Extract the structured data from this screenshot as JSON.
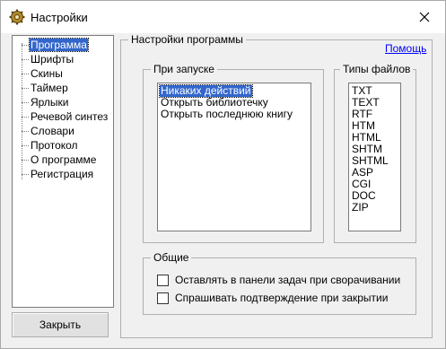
{
  "window": {
    "title": "Настройки"
  },
  "tree": {
    "items": [
      {
        "label": "Программа",
        "selected": true
      },
      {
        "label": "Шрифты"
      },
      {
        "label": "Скины"
      },
      {
        "label": "Таймер"
      },
      {
        "label": "Ярлыки"
      },
      {
        "label": "Речевой синтез"
      },
      {
        "label": "Словари"
      },
      {
        "label": "Протокол"
      },
      {
        "label": "О программе"
      },
      {
        "label": "Регистрация"
      }
    ]
  },
  "buttons": {
    "close_label": "Закрыть"
  },
  "settings_group": {
    "title": "Настройки программы",
    "help_link": "Помощь"
  },
  "startup": {
    "title": "При запуске",
    "options": [
      {
        "label": "Никаких действий",
        "selected": true
      },
      {
        "label": "Открыть библиотечку"
      },
      {
        "label": "Открыть последнюю книгу"
      }
    ]
  },
  "file_types": {
    "title": "Типы файлов",
    "items": [
      "TXT",
      "TEXT",
      "RTF",
      "HTM",
      "HTML",
      "SHTM",
      "SHTML",
      "ASP",
      "CGI",
      "DOC",
      "ZIP"
    ]
  },
  "general": {
    "title": "Общие",
    "checkboxes": [
      {
        "label": "Оставлять в панели задач при сворачивании",
        "checked": false
      },
      {
        "label": "Спрашивать подтверждение при закрытии",
        "checked": false
      }
    ]
  }
}
